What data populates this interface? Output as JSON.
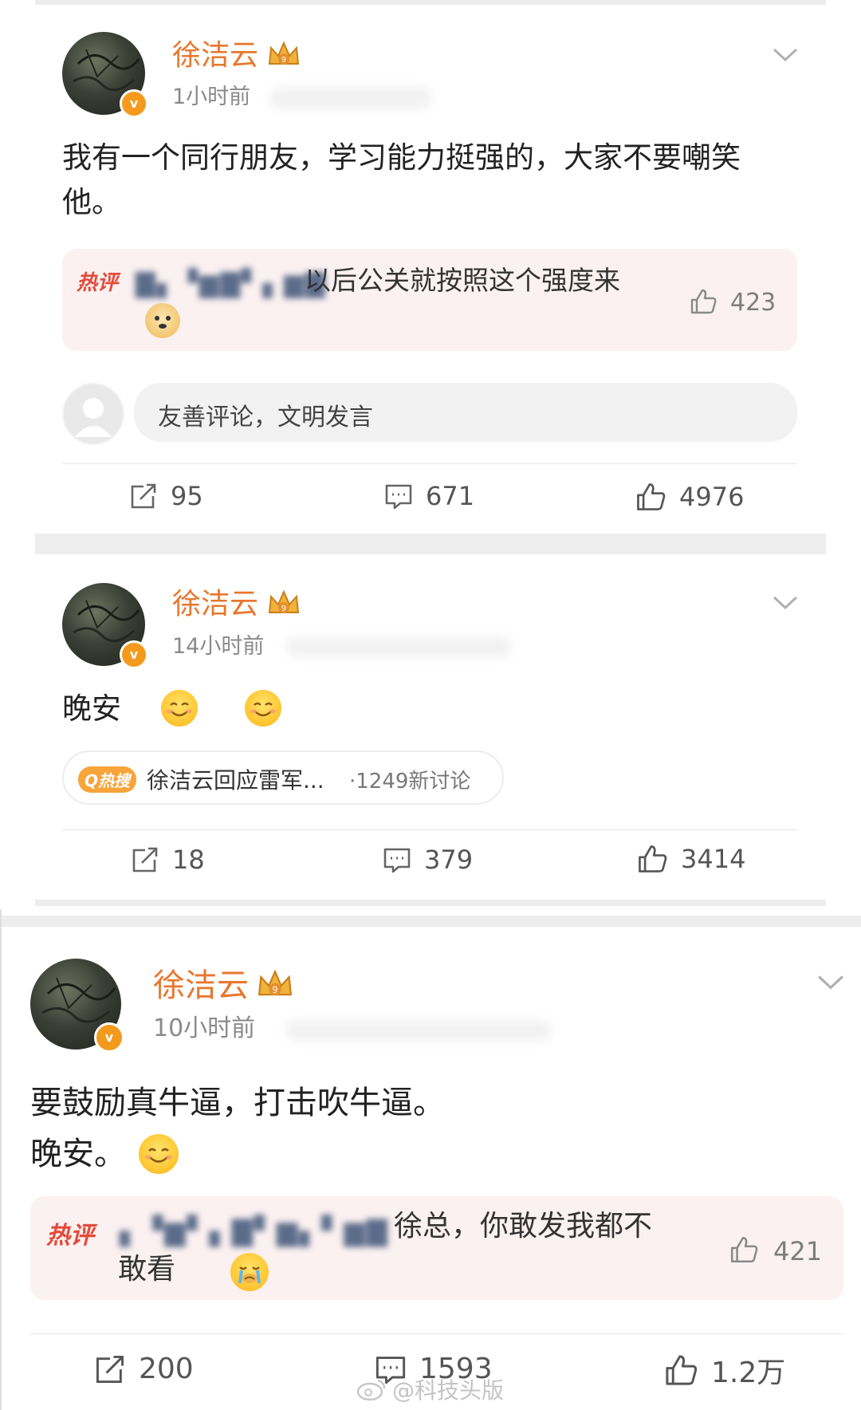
{
  "posts": [
    {
      "username": "徐洁云",
      "time": "1小时前",
      "content_lines": [
        "我有一个同行朋友，学习能力挺强的，大家不要嘲笑",
        "他。"
      ],
      "hot_comment": {
        "label": "热评",
        "text_line1": "以后公关就按照这个强度来",
        "likes": "423"
      },
      "comment_placeholder": "友善评论，文明发言",
      "reposts": "95",
      "comments": "671",
      "likes": "4976"
    },
    {
      "username": "徐洁云",
      "time": "14小时前",
      "content": "晚安",
      "topic": {
        "badge": "热搜",
        "text": "徐洁云回应雷军...",
        "count": "·1249新讨论"
      },
      "reposts": "18",
      "comments": "379",
      "likes": "3414"
    },
    {
      "username": "徐洁云",
      "time": "10小时前",
      "content_lines": [
        "要鼓励真牛逼，打击吹牛逼。",
        "晚安。"
      ],
      "hot_comment": {
        "label": "热评",
        "text_line1": "徐总，你敢发我都不",
        "text_line2": "敢看",
        "likes": "421"
      },
      "reposts": "200",
      "comments": "1593",
      "likes": "1.2万"
    }
  ],
  "watermark": "@科技头版",
  "icons": {
    "verified": "v-badge-icon",
    "crown": "crown-icon",
    "chevron": "chevron-down-icon",
    "repost": "repost-icon",
    "comment": "comment-icon",
    "like": "thumbs-up-icon"
  },
  "colors": {
    "username": "#e8772e",
    "hot_label": "#e44a3a",
    "verified": "#f39a1d"
  }
}
